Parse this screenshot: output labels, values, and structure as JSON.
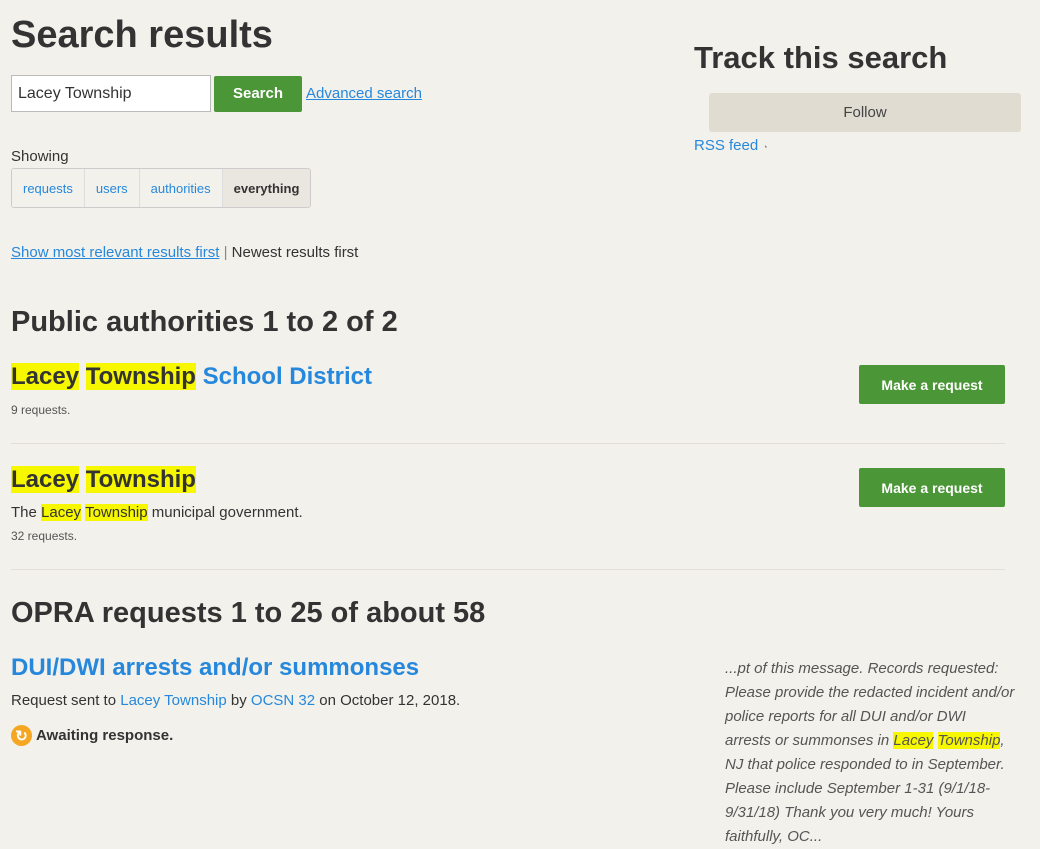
{
  "page": {
    "title": "Search results"
  },
  "search": {
    "value": "Lacey Township",
    "button_label": "Search",
    "advanced_label": "Advanced search"
  },
  "filters": {
    "label": "Showing",
    "tabs": [
      {
        "label": "requests",
        "active": false
      },
      {
        "label": "users",
        "active": false
      },
      {
        "label": "authorities",
        "active": false
      },
      {
        "label": "everything",
        "active": true
      }
    ]
  },
  "sort": {
    "relevant_label": "Show most relevant results first",
    "separator": "|",
    "current_label": "Newest results first"
  },
  "authorities": {
    "heading": "Public authorities 1 to 2 of 2",
    "items": [
      {
        "title_hl1": "Lacey",
        "title_hl2": "Township",
        "title_rest": "School District",
        "requests": "9 requests.",
        "button_label": "Make a request"
      },
      {
        "title_hl1": "Lacey",
        "title_hl2": "Township",
        "desc_pre": "The",
        "desc_hl1": "Lacey",
        "desc_hl2": "Township",
        "desc_post": "municipal government.",
        "requests": "32 requests.",
        "button_label": "Make a request"
      }
    ]
  },
  "requests": {
    "heading": "OPRA requests 1 to 25 of about 58",
    "items": [
      {
        "title": "DUI/DWI arrests and/or summonses",
        "sent_prefix": "Request sent to",
        "authority": "Lacey Township",
        "by_label": "by",
        "user": "OCSN 32",
        "date_text": "on October 12, 2018.",
        "status": "Awaiting response.",
        "excerpt_pre": "...pt of this message. Records requested: Please provide the redacted incident and/or police reports for all DUI and/or DWI arrests or summonses in",
        "excerpt_hl1": "Lacey",
        "excerpt_hl2": "Township",
        "excerpt_post": ", NJ that police responded to in September. Please include September 1-31 (9/1/18-9/31/18) Thank you very much! Yours faithfully, OC..."
      }
    ]
  },
  "track": {
    "title": "Track this search",
    "follow_label": "Follow",
    "rss_label": "RSS feed"
  },
  "icons": {
    "rss": "rss-icon",
    "status": "refresh-icon"
  },
  "colors": {
    "link": "#2688dc",
    "button_green": "#4b9637",
    "highlight": "#f7f700",
    "status_orange": "#f5a623"
  }
}
